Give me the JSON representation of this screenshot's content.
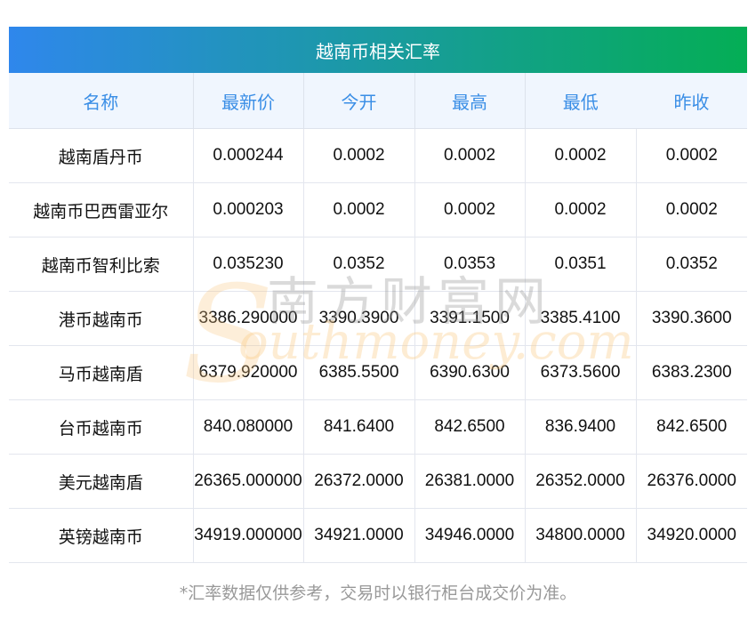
{
  "title": "越南币相关汇率",
  "headers": [
    "名称",
    "最新价",
    "今开",
    "最高",
    "最低",
    "昨收"
  ],
  "rows": [
    [
      "越南盾丹币",
      "0.000244",
      "0.0002",
      "0.0002",
      "0.0002",
      "0.0002"
    ],
    [
      "越南币巴西雷亚尔",
      "0.000203",
      "0.0002",
      "0.0002",
      "0.0002",
      "0.0002"
    ],
    [
      "越南币智利比索",
      "0.035230",
      "0.0352",
      "0.0353",
      "0.0351",
      "0.0352"
    ],
    [
      "港币越南币",
      "3386.290000",
      "3390.3900",
      "3391.1500",
      "3385.4100",
      "3390.3600"
    ],
    [
      "马币越南盾",
      "6379.920000",
      "6385.5500",
      "6390.6300",
      "6373.5600",
      "6383.2300"
    ],
    [
      "台币越南币",
      "840.080000",
      "841.6400",
      "842.6500",
      "836.9400",
      "842.6500"
    ],
    [
      "美元越南盾",
      "26365.000000",
      "26372.0000",
      "26381.0000",
      "26352.0000",
      "26376.0000"
    ],
    [
      "英镑越南币",
      "34919.000000",
      "34921.0000",
      "34946.0000",
      "34800.0000",
      "34920.0000"
    ]
  ],
  "note": "*汇率数据仅供参考，交易时以银行柜台成交价为准。",
  "watermark": {
    "cn": "南方财富网",
    "en": "outhmoney.com",
    "s": "S"
  }
}
